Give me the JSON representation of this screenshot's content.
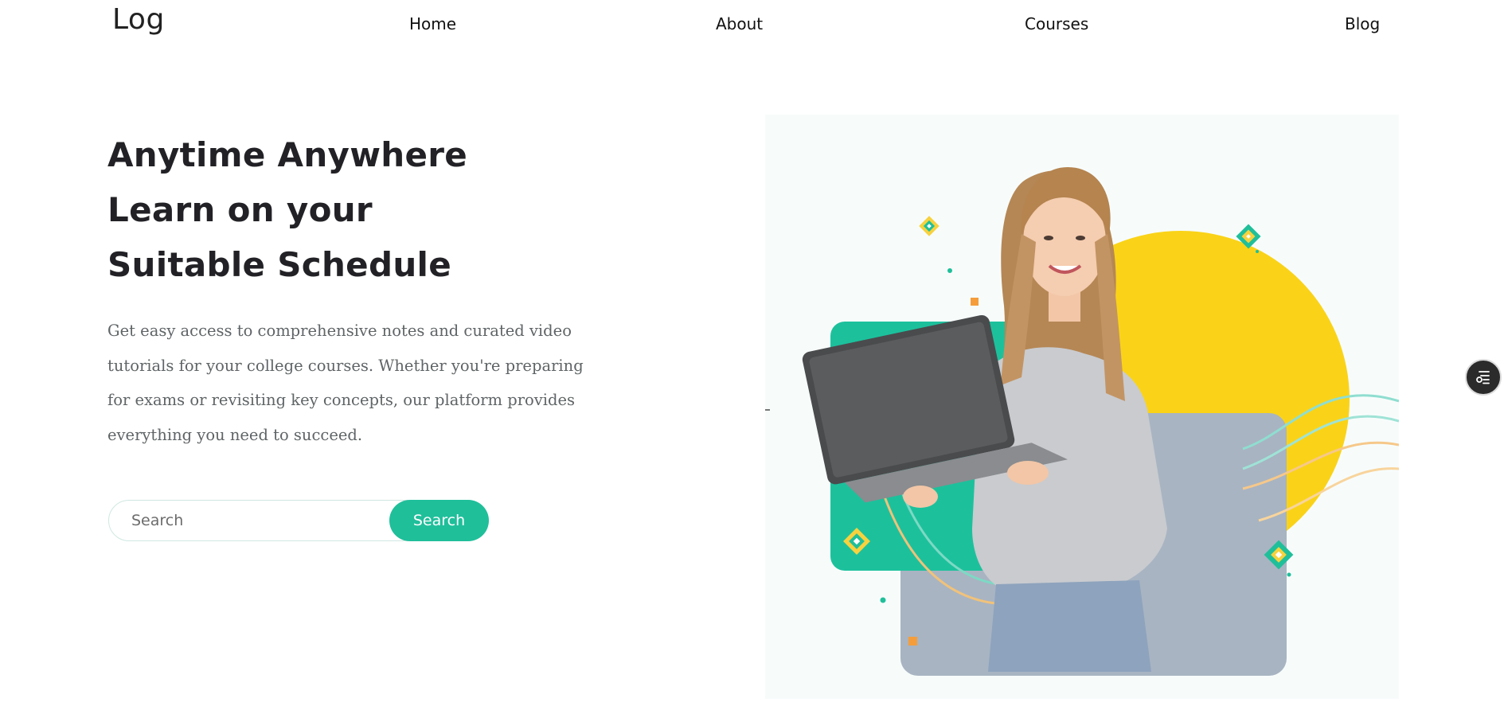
{
  "nav": {
    "logo": "Log",
    "links": [
      {
        "label": "Home"
      },
      {
        "label": "About"
      },
      {
        "label": "Courses"
      },
      {
        "label": "Blog"
      }
    ]
  },
  "hero": {
    "headline_lines": [
      "Anytime Anywhere",
      "Learn on your",
      "Suitable Schedule"
    ],
    "description": "Get easy access to comprehensive notes and curated video tutorials for your college courses. Whether you're preparing for exams or revisiting key concepts, our platform provides everything you need to succeed.",
    "image_icon": "student-with-laptop-illustration"
  },
  "search": {
    "placeholder": "Search",
    "value": "",
    "button_label": "Search"
  },
  "floating_button": {
    "icon": "settings-menu-icon"
  },
  "colors": {
    "accent": "#1fbf9a",
    "headline": "#222226",
    "body_text": "#5f6466",
    "yellow_circle": "#fad318",
    "teal_card": "#1cc19c",
    "slate_card": "#a8b4c2"
  }
}
